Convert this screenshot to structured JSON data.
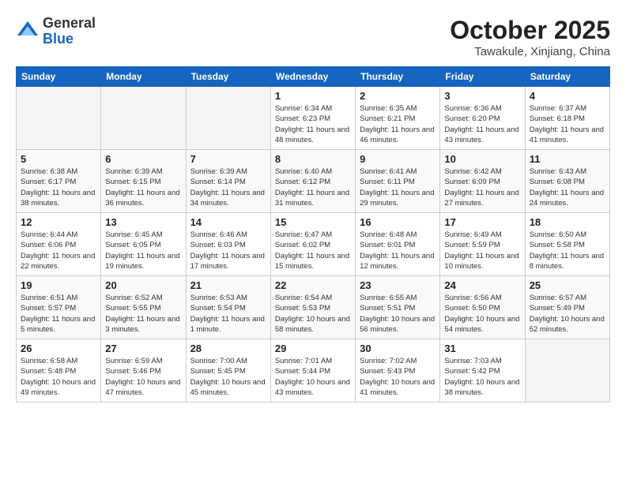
{
  "header": {
    "logo": {
      "general": "General",
      "blue": "Blue"
    },
    "month": "October 2025",
    "location": "Tawakule, Xinjiang, China"
  },
  "weekdays": [
    "Sunday",
    "Monday",
    "Tuesday",
    "Wednesday",
    "Thursday",
    "Friday",
    "Saturday"
  ],
  "weeks": [
    [
      {
        "day": "",
        "empty": true
      },
      {
        "day": "",
        "empty": true
      },
      {
        "day": "",
        "empty": true
      },
      {
        "day": "1",
        "sunrise": "Sunrise: 6:34 AM",
        "sunset": "Sunset: 6:23 PM",
        "daylight": "Daylight: 11 hours and 48 minutes."
      },
      {
        "day": "2",
        "sunrise": "Sunrise: 6:35 AM",
        "sunset": "Sunset: 6:21 PM",
        "daylight": "Daylight: 11 hours and 46 minutes."
      },
      {
        "day": "3",
        "sunrise": "Sunrise: 6:36 AM",
        "sunset": "Sunset: 6:20 PM",
        "daylight": "Daylight: 11 hours and 43 minutes."
      },
      {
        "day": "4",
        "sunrise": "Sunrise: 6:37 AM",
        "sunset": "Sunset: 6:18 PM",
        "daylight": "Daylight: 11 hours and 41 minutes."
      }
    ],
    [
      {
        "day": "5",
        "sunrise": "Sunrise: 6:38 AM",
        "sunset": "Sunset: 6:17 PM",
        "daylight": "Daylight: 11 hours and 38 minutes."
      },
      {
        "day": "6",
        "sunrise": "Sunrise: 6:39 AM",
        "sunset": "Sunset: 6:15 PM",
        "daylight": "Daylight: 11 hours and 36 minutes."
      },
      {
        "day": "7",
        "sunrise": "Sunrise: 6:39 AM",
        "sunset": "Sunset: 6:14 PM",
        "daylight": "Daylight: 11 hours and 34 minutes."
      },
      {
        "day": "8",
        "sunrise": "Sunrise: 6:40 AM",
        "sunset": "Sunset: 6:12 PM",
        "daylight": "Daylight: 11 hours and 31 minutes."
      },
      {
        "day": "9",
        "sunrise": "Sunrise: 6:41 AM",
        "sunset": "Sunset: 6:11 PM",
        "daylight": "Daylight: 11 hours and 29 minutes."
      },
      {
        "day": "10",
        "sunrise": "Sunrise: 6:42 AM",
        "sunset": "Sunset: 6:09 PM",
        "daylight": "Daylight: 11 hours and 27 minutes."
      },
      {
        "day": "11",
        "sunrise": "Sunrise: 6:43 AM",
        "sunset": "Sunset: 6:08 PM",
        "daylight": "Daylight: 11 hours and 24 minutes."
      }
    ],
    [
      {
        "day": "12",
        "sunrise": "Sunrise: 6:44 AM",
        "sunset": "Sunset: 6:06 PM",
        "daylight": "Daylight: 11 hours and 22 minutes."
      },
      {
        "day": "13",
        "sunrise": "Sunrise: 6:45 AM",
        "sunset": "Sunset: 6:05 PM",
        "daylight": "Daylight: 11 hours and 19 minutes."
      },
      {
        "day": "14",
        "sunrise": "Sunrise: 6:46 AM",
        "sunset": "Sunset: 6:03 PM",
        "daylight": "Daylight: 11 hours and 17 minutes."
      },
      {
        "day": "15",
        "sunrise": "Sunrise: 6:47 AM",
        "sunset": "Sunset: 6:02 PM",
        "daylight": "Daylight: 11 hours and 15 minutes."
      },
      {
        "day": "16",
        "sunrise": "Sunrise: 6:48 AM",
        "sunset": "Sunset: 6:01 PM",
        "daylight": "Daylight: 11 hours and 12 minutes."
      },
      {
        "day": "17",
        "sunrise": "Sunrise: 6:49 AM",
        "sunset": "Sunset: 5:59 PM",
        "daylight": "Daylight: 11 hours and 10 minutes."
      },
      {
        "day": "18",
        "sunrise": "Sunrise: 6:50 AM",
        "sunset": "Sunset: 5:58 PM",
        "daylight": "Daylight: 11 hours and 8 minutes."
      }
    ],
    [
      {
        "day": "19",
        "sunrise": "Sunrise: 6:51 AM",
        "sunset": "Sunset: 5:57 PM",
        "daylight": "Daylight: 11 hours and 5 minutes."
      },
      {
        "day": "20",
        "sunrise": "Sunrise: 6:52 AM",
        "sunset": "Sunset: 5:55 PM",
        "daylight": "Daylight: 11 hours and 3 minutes."
      },
      {
        "day": "21",
        "sunrise": "Sunrise: 6:53 AM",
        "sunset": "Sunset: 5:54 PM",
        "daylight": "Daylight: 11 hours and 1 minute."
      },
      {
        "day": "22",
        "sunrise": "Sunrise: 6:54 AM",
        "sunset": "Sunset: 5:53 PM",
        "daylight": "Daylight: 10 hours and 58 minutes."
      },
      {
        "day": "23",
        "sunrise": "Sunrise: 6:55 AM",
        "sunset": "Sunset: 5:51 PM",
        "daylight": "Daylight: 10 hours and 56 minutes."
      },
      {
        "day": "24",
        "sunrise": "Sunrise: 6:56 AM",
        "sunset": "Sunset: 5:50 PM",
        "daylight": "Daylight: 10 hours and 54 minutes."
      },
      {
        "day": "25",
        "sunrise": "Sunrise: 6:57 AM",
        "sunset": "Sunset: 5:49 PM",
        "daylight": "Daylight: 10 hours and 52 minutes."
      }
    ],
    [
      {
        "day": "26",
        "sunrise": "Sunrise: 6:58 AM",
        "sunset": "Sunset: 5:48 PM",
        "daylight": "Daylight: 10 hours and 49 minutes."
      },
      {
        "day": "27",
        "sunrise": "Sunrise: 6:59 AM",
        "sunset": "Sunset: 5:46 PM",
        "daylight": "Daylight: 10 hours and 47 minutes."
      },
      {
        "day": "28",
        "sunrise": "Sunrise: 7:00 AM",
        "sunset": "Sunset: 5:45 PM",
        "daylight": "Daylight: 10 hours and 45 minutes."
      },
      {
        "day": "29",
        "sunrise": "Sunrise: 7:01 AM",
        "sunset": "Sunset: 5:44 PM",
        "daylight": "Daylight: 10 hours and 43 minutes."
      },
      {
        "day": "30",
        "sunrise": "Sunrise: 7:02 AM",
        "sunset": "Sunset: 5:43 PM",
        "daylight": "Daylight: 10 hours and 41 minutes."
      },
      {
        "day": "31",
        "sunrise": "Sunrise: 7:03 AM",
        "sunset": "Sunset: 5:42 PM",
        "daylight": "Daylight: 10 hours and 38 minutes."
      },
      {
        "day": "",
        "empty": true
      }
    ]
  ]
}
